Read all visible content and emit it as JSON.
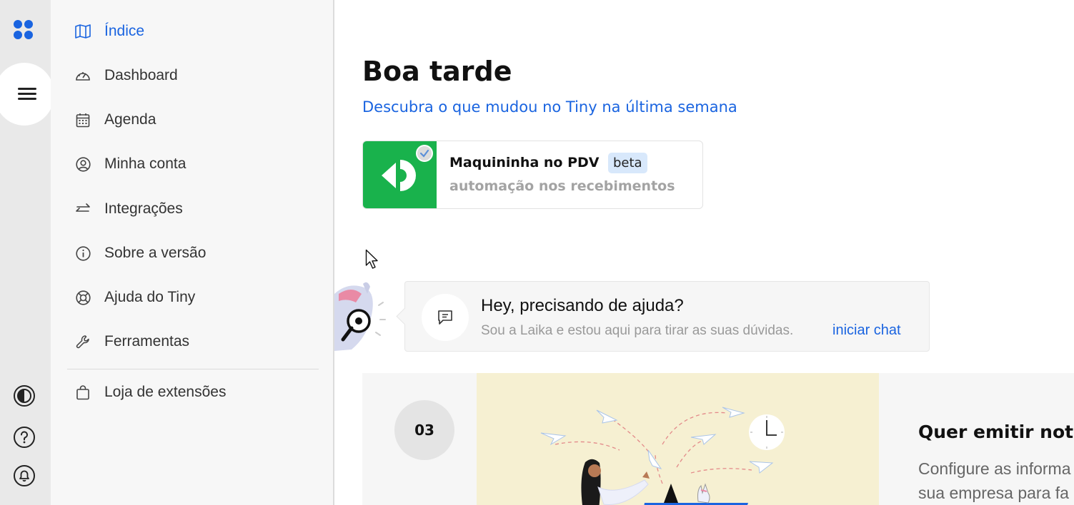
{
  "sidebar": {
    "items": [
      {
        "label": "Índice",
        "icon": "map-icon",
        "active": true
      },
      {
        "label": "Dashboard",
        "icon": "gauge-icon"
      },
      {
        "label": "Agenda",
        "icon": "calendar-icon"
      },
      {
        "label": "Minha conta",
        "icon": "user-circle-icon"
      },
      {
        "label": "Integrações",
        "icon": "arrows-icon"
      },
      {
        "label": "Sobre a versão",
        "icon": "info-icon"
      },
      {
        "label": "Ajuda do Tiny",
        "icon": "lifebuoy-icon"
      },
      {
        "label": "Ferramentas",
        "icon": "wrench-icon"
      },
      {
        "label": "Loja de extensões",
        "icon": "shopping-bag-icon"
      }
    ]
  },
  "rail": {
    "icons": [
      "app-logo-icon",
      "menu-icon",
      "contrast-icon",
      "help-icon",
      "bell-icon"
    ]
  },
  "main": {
    "greeting": "Boa tarde",
    "news_link": "Descubra o que mudou no Tiny na última semana",
    "promo": {
      "title": "Maquininha no PDV",
      "badge": "beta",
      "subtitle": "automação nos recebimentos"
    },
    "help": {
      "title": "Hey, precisando de ajuda?",
      "subtitle": "Sou a Laika e estou aqui para tirar as suas dúvidas.",
      "link": "iniciar chat"
    },
    "step": {
      "number": "03",
      "title": "Quer emitir nota",
      "text_line1": "Configure as informa",
      "text_line2": "sua empresa para fa"
    }
  },
  "colors": {
    "accent": "#1a64e0",
    "promo_green": "#19b24c",
    "badge_bg": "#d8e8fb",
    "illustration_bg": "#f6f0d2"
  }
}
